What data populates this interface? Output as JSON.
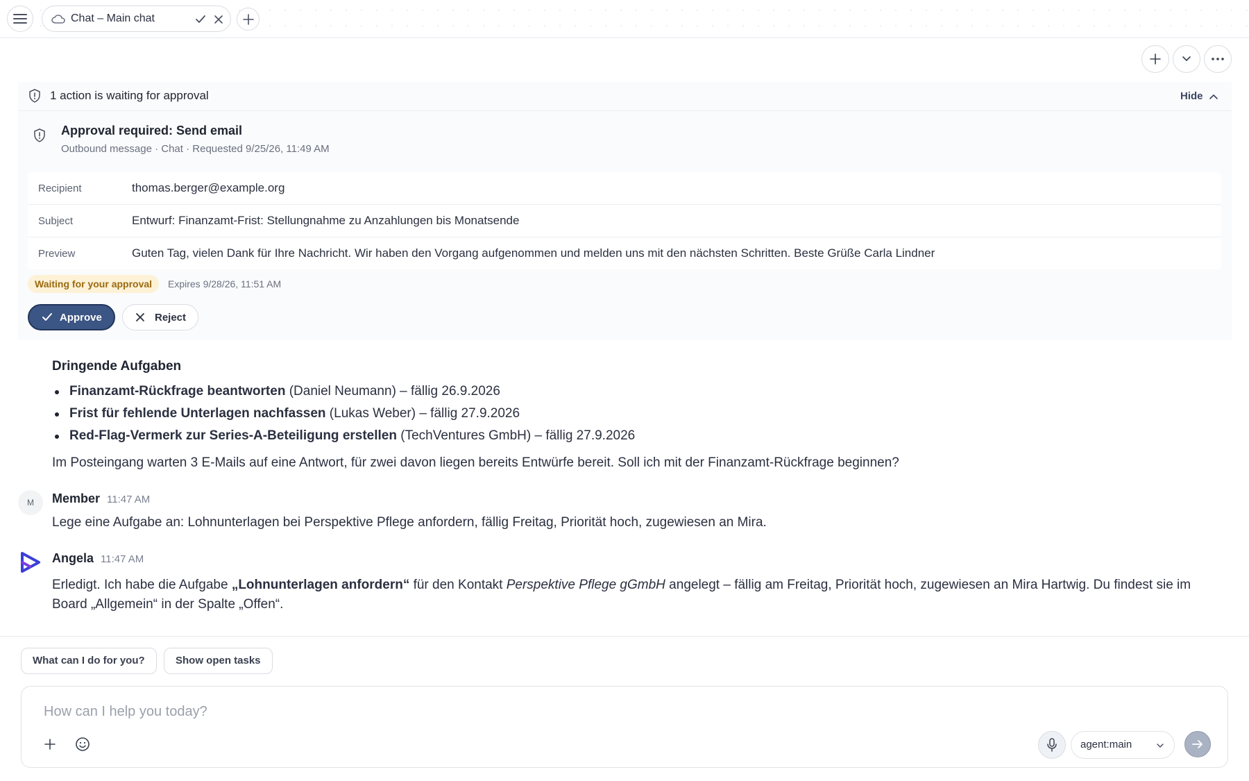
{
  "tabbar": {
    "tab_title": "Chat – Main chat"
  },
  "approval": {
    "header_text": "1 action is waiting for approval",
    "hide_label": "Hide",
    "title": "Approval required: Send email",
    "subtitle": "Outbound message · Chat · Requested 9/25/26, 11:49 AM",
    "rows": [
      {
        "key": "Recipient",
        "value": "thomas.berger@example.org"
      },
      {
        "key": "Subject",
        "value": "Entwurf: Finanzamt-Frist: Stellungnahme zu Anzahlungen bis Monatsende"
      },
      {
        "key": "Preview",
        "value": "Guten Tag, vielen Dank für Ihre Nachricht. Wir haben den Vorgang aufgenommen und melden uns mit den nächsten Schritten. Beste Grüße Carla Lindner"
      }
    ],
    "status_badge": "Waiting for your approval",
    "expires": "Expires 9/28/26, 11:51 AM",
    "approve_label": "Approve",
    "reject_label": "Reject"
  },
  "assistant_summary": {
    "heading": "Dringende Aufgaben",
    "tasks": [
      {
        "title": "Finanzamt-Rückfrage beantworten",
        "detail": " (Daniel Neumann) – fällig 26.9.2026"
      },
      {
        "title": "Frist für fehlende Unterlagen nachfassen",
        "detail": " (Lukas Weber) – fällig 27.9.2026"
      },
      {
        "title": "Red-Flag-Vermerk zur Series-A-Beteiligung erstellen",
        "detail": " (TechVentures GmbH) – fällig 27.9.2026"
      }
    ],
    "closing": "Im Posteingang warten 3 E-Mails auf eine Antwort, für zwei davon liegen bereits Entwürfe bereit. Soll ich mit der Finanzamt-Rückfrage beginnen?"
  },
  "messages": [
    {
      "avatar_letter": "M",
      "author": "Member",
      "time": "11:47 AM",
      "text": "Lege eine Aufgabe an: Lohnunterlagen bei Perspektive Pflege anfordern, fällig Freitag, Priorität hoch, zugewiesen an Mira."
    },
    {
      "author": "Angela",
      "time": "11:47 AM",
      "text_1": "Erledigt. Ich habe die Aufgabe ",
      "text_bold": "„Lohnunterlagen anfordern“",
      "text_2": " für den Kontakt ",
      "text_italic": "Perspektive Pflege gGmbH",
      "text_3": " angelegt – fällig am Freitag, Priorität hoch, zugewiesen an Mira Hartwig. Du findest sie im",
      "text_4": "Board „Allgemein“ in der Spalte „Offen“."
    }
  ],
  "suggestions": [
    "What can I do for you?",
    "Show open tasks"
  ],
  "composer": {
    "placeholder": "How can I help you today?",
    "agent": "agent:main"
  },
  "colors": {
    "approve_bg": "#3b5584",
    "badge_bg": "#fdf1d6",
    "badge_text": "#9a6a10",
    "angela_logo": "#3b3fd8"
  }
}
